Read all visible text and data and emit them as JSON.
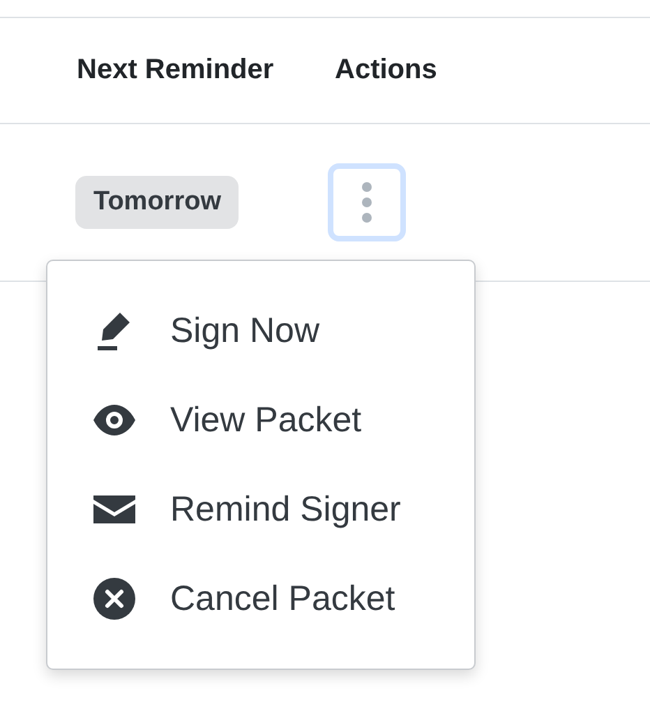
{
  "table": {
    "columns": [
      "Next Reminder",
      "Actions"
    ],
    "rows": [
      {
        "next_reminder": "Tomorrow",
        "actions_focused": true
      }
    ]
  },
  "menu": {
    "items": [
      {
        "kind": "sign",
        "label": "Sign Now"
      },
      {
        "kind": "view",
        "label": "View Packet"
      },
      {
        "kind": "remind",
        "label": "Remind Signer"
      },
      {
        "kind": "cancel",
        "label": "Cancel Packet"
      }
    ]
  }
}
